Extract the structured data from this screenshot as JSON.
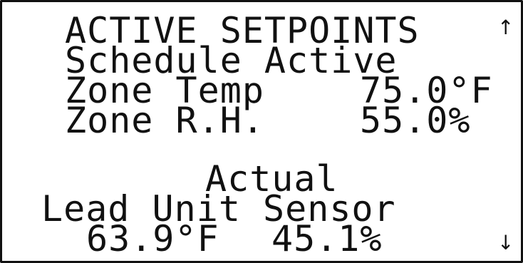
{
  "screen": {
    "title": "ACTIVE SETPOINTS",
    "schedule_status": "Schedule Active",
    "zone_temp": {
      "label": "Zone Temp",
      "value": "75.0°F"
    },
    "zone_rh": {
      "label": "Zone R.H.",
      "value": "55.0%"
    },
    "actual_heading": "Actual",
    "sensor_heading": "Lead Unit Sensor",
    "sensor_temp": "63.9°F",
    "sensor_rh": "45.1%",
    "scroll_up_icon": "up-arrow-icon",
    "scroll_down_icon": "down-arrow-icon"
  },
  "colors": {
    "background": "#ffffff",
    "text": "#111111"
  }
}
